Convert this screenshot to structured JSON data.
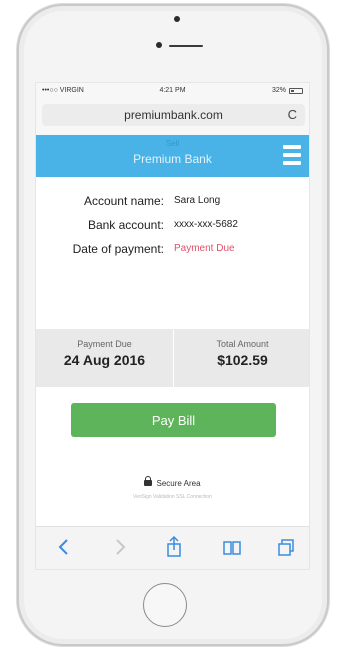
{
  "status_bar": {
    "carrier": "•••○○ VIRGIN",
    "time": "4:21 PM",
    "battery": "32%"
  },
  "browser": {
    "url": "premiumbank.com",
    "reload_icon": "reload-icon"
  },
  "header": {
    "logo_text": "Sell",
    "brand": "Premium Bank",
    "menu_icon": "hamburger-icon"
  },
  "account": {
    "name_label": "Account name:",
    "name_value": "Sara Long",
    "bank_label": "Bank account:",
    "bank_value": "xxxx-xxx-5682",
    "date_label": "Date of payment:",
    "date_value": "Payment Due"
  },
  "summary": {
    "due_label": "Payment Due",
    "due_value": "24 Aug 2016",
    "total_label": "Total Amount",
    "total_value": "$102.59"
  },
  "actions": {
    "pay_label": "Pay Bill"
  },
  "security": {
    "label": "Secure Area",
    "sub": "VeriSign Validation SSL Connection"
  },
  "toolbar": {
    "back": "back-icon",
    "forward": "forward-icon",
    "share": "share-icon",
    "bookmarks": "bookmarks-icon",
    "tabs": "tabs-icon"
  },
  "colors": {
    "header_blue": "#49b3e8",
    "pay_green": "#5db45a",
    "due_red": "#e0506a",
    "toolbar_blue": "#3b8be0"
  }
}
